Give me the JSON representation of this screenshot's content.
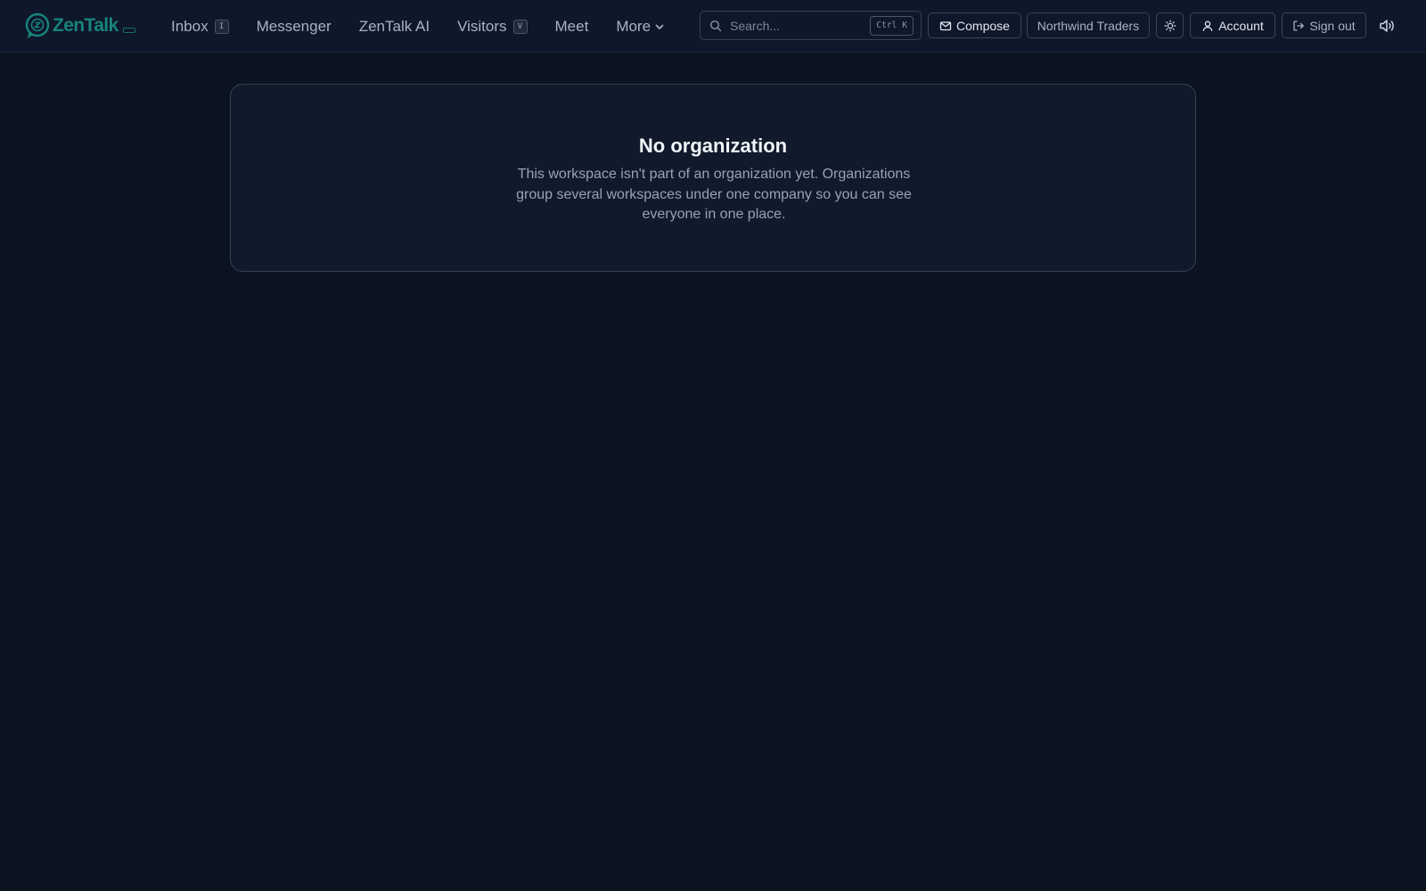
{
  "app": {
    "brand": "ZenTalk",
    "brand_color": "#16847a",
    "background_color": "#0b1220"
  },
  "nav": {
    "items": [
      {
        "label": "Inbox",
        "shortcut": "I"
      },
      {
        "label": "Messenger"
      },
      {
        "label": "ZenTalk AI"
      },
      {
        "label": "Visitors",
        "shortcut": "V"
      },
      {
        "label": "Meet"
      },
      {
        "label": "More",
        "icon": "chevron-down-icon"
      }
    ]
  },
  "search": {
    "placeholder": "Search...",
    "value": "",
    "shortcut_modifier": "Ctrl",
    "shortcut_key": "K",
    "icon": "search-icon"
  },
  "toolbar": {
    "compose_label": "Compose",
    "compose_icon": "mail-icon",
    "workspace_label": "Northwind Traders",
    "theme_toggle_icon": "sun-icon",
    "account_label": "Account",
    "account_icon": "user-icon",
    "sign_out_label": "Sign out",
    "sign_out_icon": "log-out-icon",
    "sound_icon": "volume-icon"
  },
  "empty_state": {
    "title": "No organization",
    "description": "This workspace isn't part of an organization yet. Organizations group several workspaces under one company so you can see everyone in one place."
  }
}
